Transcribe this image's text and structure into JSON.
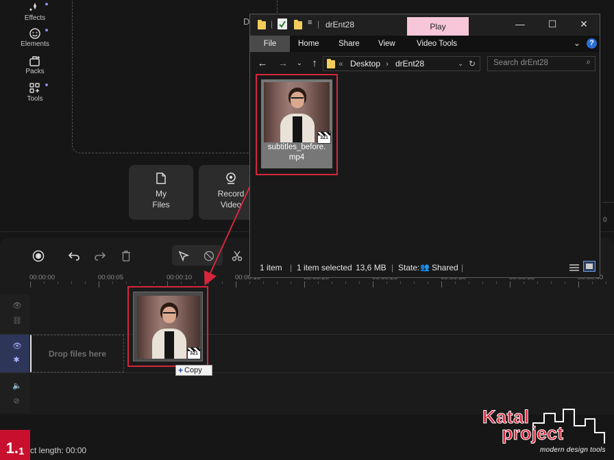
{
  "editor": {
    "rail": [
      {
        "label": "Effects",
        "icon": "effects-icon"
      },
      {
        "label": "Elements",
        "icon": "elements-icon"
      },
      {
        "label": "Packs",
        "icon": "packs-icon"
      },
      {
        "label": "Tools",
        "icon": "tools-icon"
      }
    ],
    "preview_hint": "D",
    "source_buttons": [
      {
        "label_line1": "My",
        "label_line2": "Files",
        "icon": "file-icon"
      },
      {
        "label_line1": "Record",
        "label_line2": "Video",
        "icon": "webcam-icon"
      }
    ],
    "right_strip_text": "0",
    "timeline": {
      "ticks": [
        "00:00:00",
        "00:00:05",
        "00:00:10",
        "00:00:15",
        "00:00:20",
        "00:00:25",
        "00:00:30",
        "00:00:35",
        "00:00:40"
      ],
      "drop_label": "Drop files here",
      "copy_tooltip": "Copy",
      "project_length": "ct length: 00:00"
    },
    "step_badge": {
      "main": "1.",
      "sub": "1"
    }
  },
  "explorer": {
    "title": "drEnt28",
    "context_tab": "Play",
    "ribbon_tabs": [
      "File",
      "Home",
      "Share",
      "View",
      "Video Tools"
    ],
    "breadcrumb": [
      "Desktop",
      "drEnt28"
    ],
    "breadcrumb_prefix": "«",
    "search_placeholder": "Search drEnt28",
    "file": {
      "name_line1": "subtitles_before.",
      "name_line2": "mp4",
      "clapper_text": "321"
    },
    "status": {
      "count": "1 item",
      "selected": "1 item selected",
      "size": "13,6 MB",
      "state_label": "State:",
      "state_value": "Shared"
    }
  },
  "logo": {
    "line1": "Katal",
    "line2": "project",
    "tagline": "modern design tools"
  },
  "colors": {
    "accent_red": "#d7263d",
    "play_tab": "#f7c6d8",
    "active_track": "#2d3559",
    "folder": "#f3cd5b"
  }
}
